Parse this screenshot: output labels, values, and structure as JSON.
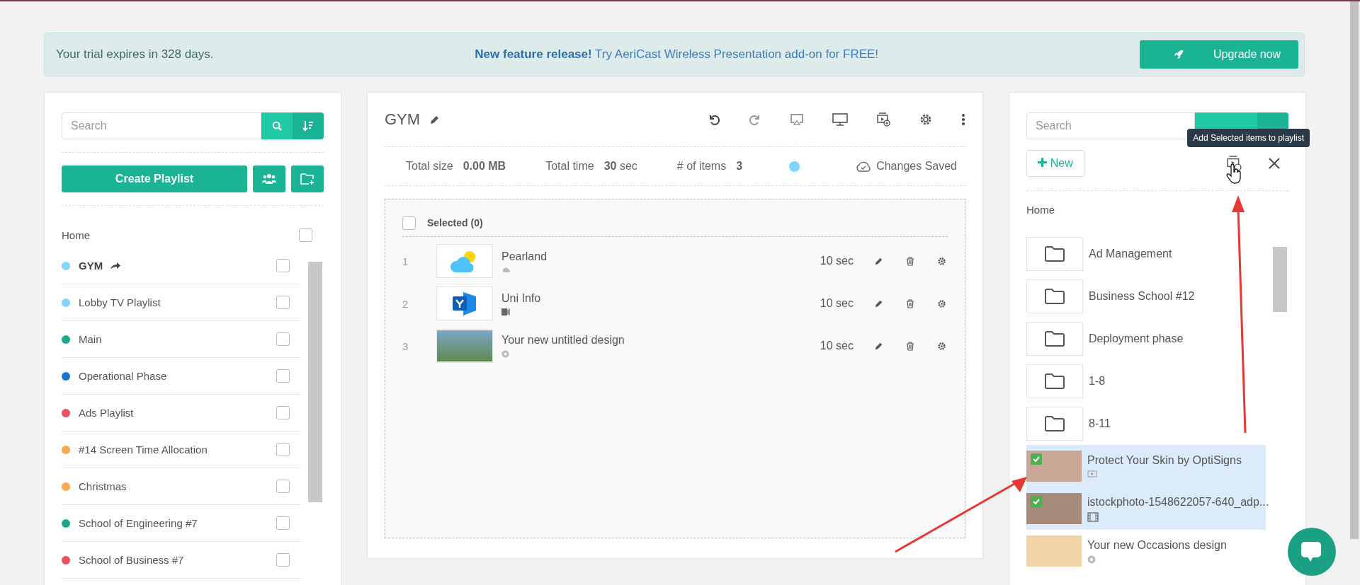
{
  "banner": {
    "trial": "Your trial expires in 328 days.",
    "feature": "**New feature release!** Try AeriCast Wireless Presentation add-on for FREE!",
    "button": "Upgrade now"
  },
  "left": {
    "search": {
      "placeholder": "Search"
    },
    "create_button": "Create Playlist",
    "home": {
      "label": "Home",
      "checked": false
    },
    "playlists": [
      {
        "name": "GYM",
        "color": "#81d4fa",
        "selected": true,
        "checked": false
      },
      {
        "name": "Lobby TV Playlist",
        "color": "#81d4fa",
        "selected": false,
        "checked": false
      },
      {
        "name": "Main",
        "color": "#1aaa8a",
        "selected": false,
        "checked": false
      },
      {
        "name": "Operational Phase",
        "color": "#1976d2",
        "selected": false,
        "checked": false
      },
      {
        "name": "Ads Playlist",
        "color": "#ec4f5f",
        "selected": false,
        "checked": false
      },
      {
        "name": "#14 Screen Time Allocation",
        "color": "#f9a94f",
        "selected": false,
        "checked": false
      },
      {
        "name": "Christmas",
        "color": "#f9a94f",
        "selected": false,
        "checked": false
      },
      {
        "name": "School of Engineering #7",
        "color": "#1aaa8a",
        "selected": false,
        "checked": false
      },
      {
        "name": "School of Business #7",
        "color": "#ec4f5f",
        "selected": false,
        "checked": false
      }
    ]
  },
  "playlist": {
    "title": "GYM",
    "stats": [
      {
        "label": "Total size",
        "value": "**0.00 MB**"
      },
      {
        "label": "Total time",
        "value": "**30** sec"
      },
      {
        "label": "# of items",
        "value": "**3**"
      }
    ],
    "status": "Changes Saved",
    "selected_header": {
      "label": "Selected (0)",
      "checked": false
    },
    "items": [
      {
        "index": "1",
        "name": "Pearland",
        "duration": "10 sec",
        "kind": "weather"
      },
      {
        "index": "2",
        "name": "Uni Info",
        "duration": "10 sec",
        "kind": "app"
      },
      {
        "index": "3",
        "name": "Your new untitled design",
        "duration": "10 sec",
        "kind": "design"
      }
    ]
  },
  "library": {
    "search": {
      "placeholder": "Search"
    },
    "new_button": "New",
    "tooltip": "Add Selected items to playlist",
    "breadcrumb": "Home",
    "folders": [
      "Ad Management",
      "Business School #12",
      "Deployment phase",
      "1-8",
      "8-11"
    ],
    "media": [
      {
        "name": "Protect Your Skin by OptiSigns",
        "kind": "video",
        "selected": true
      },
      {
        "name": "istockphoto-1548622057-640_adp...",
        "kind": "film",
        "selected": true
      },
      {
        "name": "Your new Occasions design",
        "kind": "design",
        "selected": false
      }
    ]
  }
}
